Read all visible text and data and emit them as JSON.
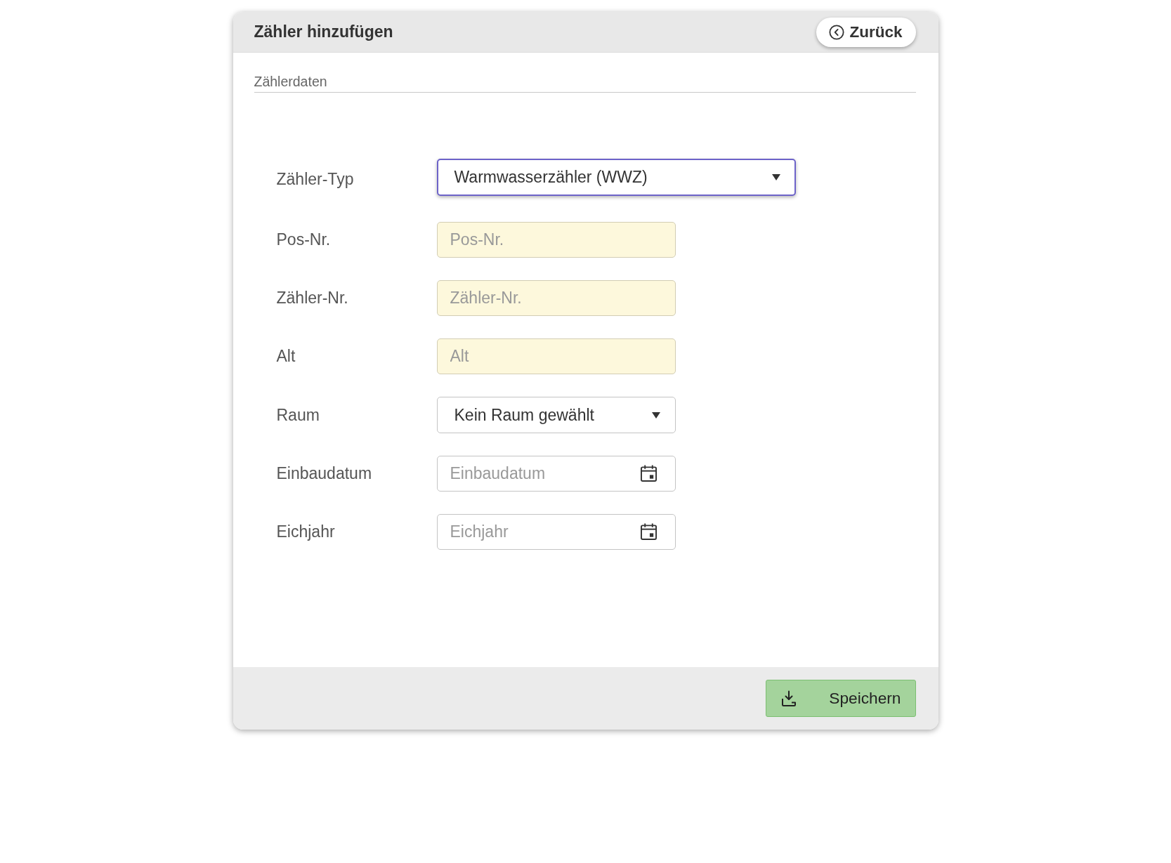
{
  "dialog": {
    "title": "Zähler hinzufügen",
    "back_button": "Zurück"
  },
  "section": {
    "title": "Zählerdaten"
  },
  "fields": [
    {
      "label": "Zähler-Typ",
      "kind": "select",
      "value": "Warmwasserzähler (WWZ)",
      "focused": true,
      "required": false
    },
    {
      "label": "Pos-Nr.",
      "kind": "text",
      "placeholder": "Pos-Nr.",
      "focused": false,
      "required": true
    },
    {
      "label": "Zähler-Nr.",
      "kind": "text",
      "placeholder": "Zähler-Nr.",
      "focused": false,
      "required": true
    },
    {
      "label": "Alt",
      "kind": "text",
      "placeholder": "Alt",
      "focused": false,
      "required": true
    },
    {
      "label": "Raum",
      "kind": "select",
      "value": "Kein Raum gewählt",
      "focused": false,
      "required": false
    },
    {
      "label": "Einbaudatum",
      "kind": "date",
      "placeholder": "Einbaudatum",
      "focused": false,
      "required": false
    },
    {
      "label": "Eichjahr",
      "kind": "date",
      "placeholder": "Eichjahr",
      "focused": false,
      "required": false
    }
  ],
  "footer": {
    "save_button": "Speichern"
  }
}
